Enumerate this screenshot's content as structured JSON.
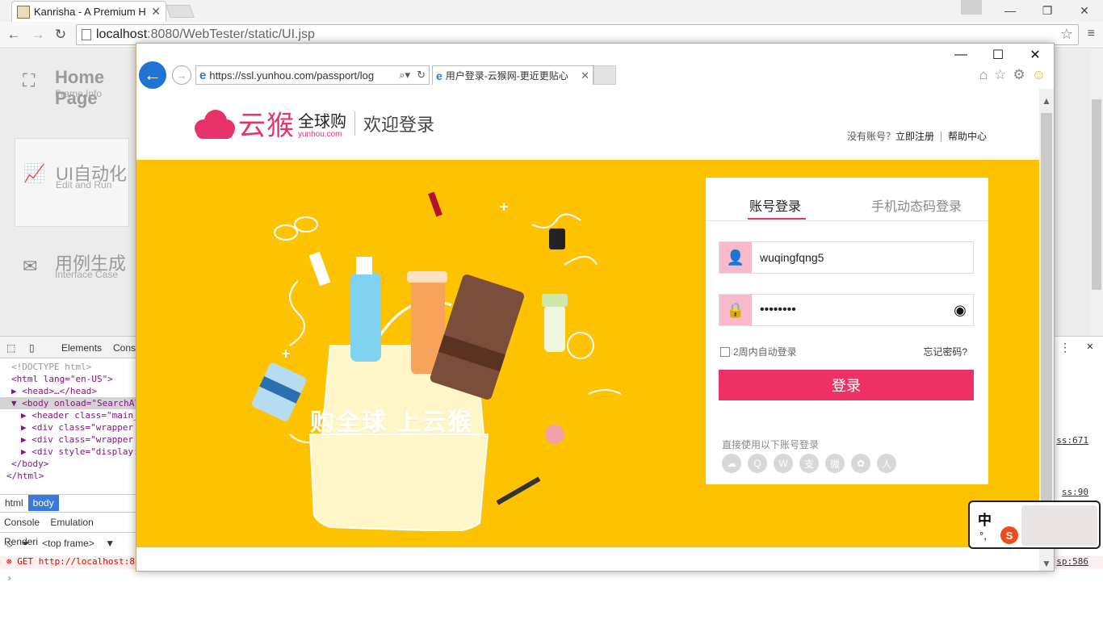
{
  "chrome": {
    "tab_title": "Kanrisha - A Premium H",
    "url_host": "localhost",
    "url_rest": ":8080/WebTester/static/UI.jsp"
  },
  "bg_app": {
    "items": [
      {
        "title": "Home Page",
        "subtitle": "Frame Info"
      },
      {
        "title": "UI自动化",
        "subtitle": "Edit and Run"
      },
      {
        "title": "用例生成",
        "subtitle": "Interface Case"
      }
    ]
  },
  "devtools": {
    "tab_elements": "Elements",
    "tab_console_short": "Cons",
    "tree": [
      "<!DOCTYPE html>",
      "<html lang=\"en-US\">",
      "▶ <head>…</head>",
      "▼ <body onload=\"SearchAl",
      "  ▶ <header class=\"main_",
      "  ▶ <div class=\"wrapper",
      "  ▶ <div class=\"wrapper",
      "  ▶ <div style=\"display:",
      "  </body>",
      "</html>"
    ],
    "crumb_html": "html",
    "crumb_body": "body",
    "console_tabs": [
      "Console",
      "Emulation",
      "Renderi"
    ],
    "frame": "<top frame>",
    "error": "GET http://localhost:8",
    "right_links": [
      "ss:671",
      "ss:90",
      "sp:586"
    ]
  },
  "ie": {
    "address": "https://ssl.yunhou.com/passport/log",
    "address_host": "yunhou.com",
    "tab_title": "用户登录-云猴网-更近更贴心"
  },
  "site": {
    "brand": "云猴",
    "brand_cn": "全球购",
    "brand_en": "yunhou.com",
    "welcome": "欢迎登录",
    "no_account": "没有账号？",
    "register": "立即注册",
    "help": "帮助中心",
    "slogan": "购全球  上云猴"
  },
  "login": {
    "tab_account": "账号登录",
    "tab_phone": "手机动态码登录",
    "username": "wuqingfqng5",
    "password": "••••••••",
    "remember": "2周内自动登录",
    "forgot": "忘记密码?",
    "submit": "登录",
    "social_label": "直接使用以下账号登录"
  },
  "ime": {
    "mode": "中",
    "punct": "°,",
    "badge": "S"
  }
}
